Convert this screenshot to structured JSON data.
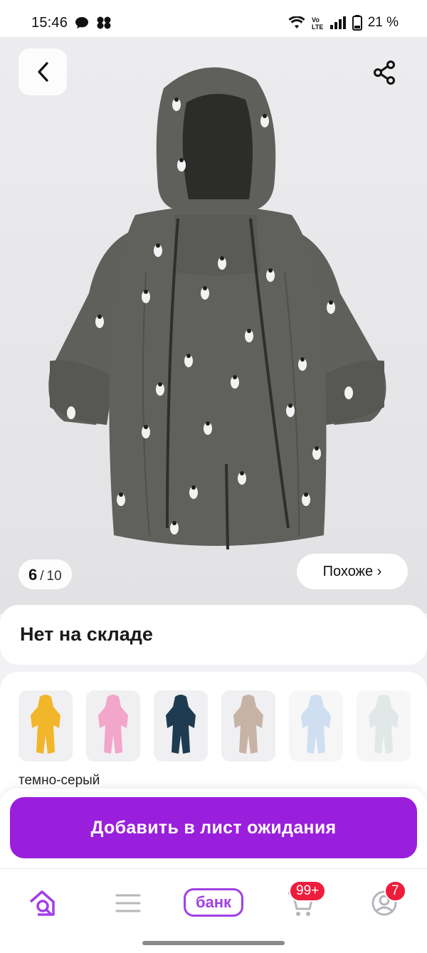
{
  "status_bar": {
    "time": "15:46",
    "battery_percent": "21 %",
    "icons": [
      "chat-bubble-icon",
      "app-cluster-icon",
      "wifi-icon",
      "volte-icon",
      "signal-icon",
      "battery-icon"
    ]
  },
  "gallery": {
    "current": "6",
    "separator": "/",
    "total": "10",
    "similar_label": "Похоже ›",
    "product_color": "#5f5f5c"
  },
  "stock": {
    "title": "Нет на складе"
  },
  "variants": {
    "selected_color_label": "темно-серый",
    "swatches": [
      {
        "name": "yellow",
        "color": "#f2b62a"
      },
      {
        "name": "pink",
        "color": "#f2a6c9"
      },
      {
        "name": "navy",
        "color": "#1f3b52"
      },
      {
        "name": "beige",
        "color": "#c7b2a6"
      },
      {
        "name": "light-blue",
        "color": "#a9c4e6"
      },
      {
        "name": "mint",
        "color": "#c9d8d6"
      }
    ]
  },
  "cta": {
    "label": "Добавить в лист ожидания",
    "color": "#9a1fdc"
  },
  "bottom_nav": {
    "bank_label": "банк",
    "cart_badge": "99+",
    "profile_badge": "7",
    "accent": "#a23fe6"
  }
}
